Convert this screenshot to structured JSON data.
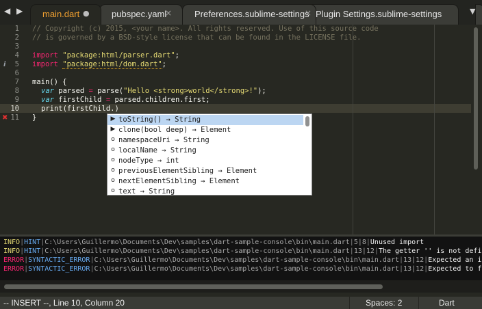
{
  "tabs": [
    {
      "label": "main.dart",
      "active": true,
      "dirty": true
    },
    {
      "label": "pubspec.yaml",
      "active": false
    },
    {
      "label": "Preferences.sublime-settings",
      "active": false
    },
    {
      "label": "Plugin Settings.sublime-settings",
      "active": false
    }
  ],
  "tab_close_glyph": "×",
  "tab_dirty_glyph": "●",
  "nav": {
    "back": "◀",
    "forward": "▶"
  },
  "tab_menu_glyph": "▼",
  "gutter": {
    "line_numbers": [
      "1",
      "2",
      "3",
      "4",
      "5",
      "6",
      "7",
      "8",
      "9",
      "10",
      "11"
    ],
    "current_line": "10",
    "markers": {
      "info_line": "5",
      "error_line": "11",
      "info_glyph": "i",
      "error_glyph": "✖"
    }
  },
  "code": {
    "line1": "// Copyright (c) 2015, <your name>. All rights reserved. Use of this source code",
    "line2": "// is governed by a BSD-style license that can be found in the LICENSE file.",
    "line4_kw": "import",
    "line4_str": "\"package:html/parser.dart\"",
    "line4_end": ";",
    "line5_kw": "import",
    "line5_str": "\"package:html/dom.dart\"",
    "line5_end": ";",
    "line7": "main() {",
    "line8_var": "var",
    "line8_a": " parsed ",
    "line8_eq": "=",
    "line8_fn": " parse(",
    "line8_str": "\"Hello <strong>world</strong>!\"",
    "line8_end": ");",
    "line9_var": "var",
    "line9_a": " firstChild ",
    "line9_eq": "=",
    "line9_b": " parsed.children.first;",
    "line10": "print(firstChild.)",
    "line11": "}"
  },
  "autocomplete": {
    "items": [
      {
        "marker": "▶",
        "text": "toString() → String",
        "selected": true
      },
      {
        "marker": "▶",
        "text": "clone(bool deep) → Element"
      },
      {
        "marker": "o",
        "text": "namespaceUri → String"
      },
      {
        "marker": "o",
        "text": "localName → String"
      },
      {
        "marker": "o",
        "text": "nodeType → int"
      },
      {
        "marker": "o",
        "text": "previousElementSibling → Element"
      },
      {
        "marker": "o",
        "text": "nextElementSibling → Element"
      },
      {
        "marker": "o",
        "text": "text → String"
      }
    ]
  },
  "output": [
    {
      "level": "INFO",
      "kind": "HINT",
      "path": "C:\\Users\\Guillermo\\Documents\\Dev\\samples\\dart-sample-console\\bin\\main.dart",
      "loc": "5|8",
      "message": "Unused import"
    },
    {
      "level": "INFO",
      "kind": "HINT",
      "path": "C:\\Users\\Guillermo\\Documents\\Dev\\samples\\dart-sample-console\\bin\\main.dart",
      "loc": "13|12",
      "message": "The getter '' is not defin"
    },
    {
      "level": "ERROR",
      "kind": "SYNTACTIC_ERROR",
      "path": "C:\\Users\\Guillermo\\Documents\\Dev\\samples\\dart-sample-console\\bin\\main.dart",
      "loc": "13|12",
      "message": "Expected an id"
    },
    {
      "level": "ERROR",
      "kind": "SYNTACTIC_ERROR",
      "path": "C:\\Users\\Guillermo\\Documents\\Dev\\samples\\dart-sample-console\\bin\\main.dart",
      "loc": "13|12",
      "message": "Expected to fi"
    }
  ],
  "status": {
    "mode_position": "-- INSERT --, Line 10, Column 20",
    "indentation": "Spaces: 2",
    "syntax": "Dart"
  },
  "colors": {
    "editor_bg": "#272822",
    "active_tab_label": "#f0a030",
    "keyword": "#f92672",
    "string": "#e6db74",
    "comment": "#75715e",
    "status_bar": "#3a3b36"
  }
}
